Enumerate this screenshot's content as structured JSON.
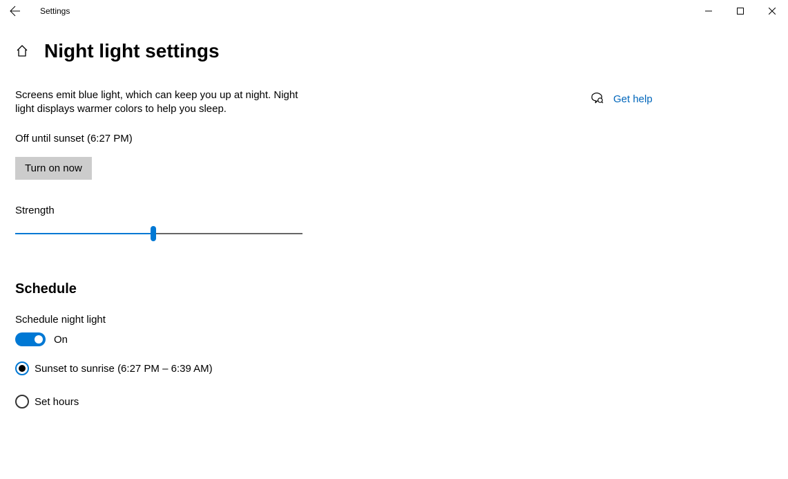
{
  "app_title": "Settings",
  "page_title": "Night light settings",
  "description": "Screens emit blue light, which can keep you up at night. Night light displays warmer colors to help you sleep.",
  "status_text": "Off until sunset (6:27 PM)",
  "turn_on_label": "Turn on now",
  "strength": {
    "label": "Strength",
    "value_percent": 48
  },
  "schedule": {
    "heading": "Schedule",
    "toggle_label": "Schedule night light",
    "toggle_state": "On",
    "options": [
      {
        "label": "Sunset to sunrise (6:27 PM – 6:39 AM)",
        "selected": true
      },
      {
        "label": "Set hours",
        "selected": false
      }
    ]
  },
  "help_link": "Get help",
  "colors": {
    "accent": "#0078d4",
    "link": "#0066bb",
    "button_bg": "#cccccc"
  }
}
